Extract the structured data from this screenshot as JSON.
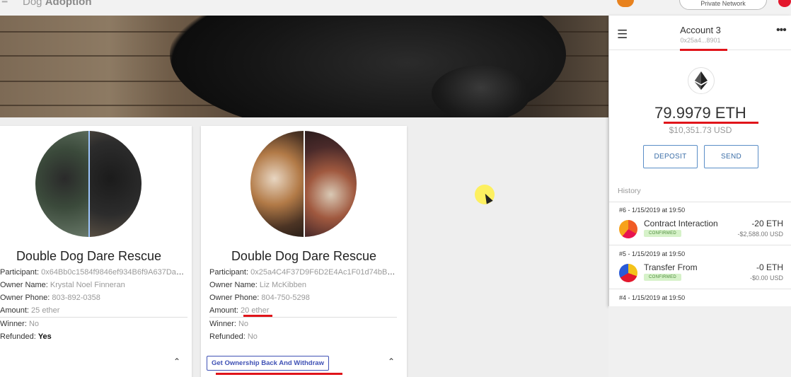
{
  "app": {
    "menu_glyph": "≡",
    "title_prefix": "Dog",
    "title_bold": "Adoption"
  },
  "cards": [
    {
      "title": "Double Dog Dare Rescue",
      "participant_label": "Participant: ",
      "participant": "0x64Bb0c1584f9846ef934B6f9A637Da90...",
      "owner_name_label": "Owner Name: ",
      "owner_name": "Krystal Noel Finneran",
      "owner_phone_label": "Owner Phone: ",
      "owner_phone": "803-892-0358",
      "amount_label": "Amount: ",
      "amount": "25 ether",
      "winner_label": "Winner: ",
      "winner": "No",
      "refunded_label": "Refunded: ",
      "refunded": "Yes",
      "collapse_icon": "chevron-up-icon"
    },
    {
      "title": "Double Dog Dare Rescue",
      "participant_label": "Participant: ",
      "participant": "0x25a4C4F37D9F6D2E4Ac1F01d74bBEf7...",
      "owner_name_label": "Owner Name: ",
      "owner_name": "Liz McKibben",
      "owner_phone_label": "Owner Phone: ",
      "owner_phone": "804-750-5298",
      "amount_label": "Amount: ",
      "amount": "20 ether",
      "winner_label": "Winner: ",
      "winner": "No",
      "refunded_label": "Refunded: ",
      "refunded": "No",
      "action_button": "Get Ownership Back And Withdraw",
      "collapse_icon": "chevron-up-icon"
    }
  ],
  "wallet": {
    "network": "Private Network",
    "account_name": "Account 3",
    "account_address": "0x25a4...8901",
    "balance": "79.9979 ETH",
    "balance_usd": "$10,351.73 USD",
    "deposit_label": "DEPOSIT",
    "send_label": "SEND",
    "history_label": "History",
    "transactions": [
      {
        "date": "#6 - 1/15/2019 at 19:50",
        "title": "Contract Interaction",
        "status": "CONFIRMED",
        "amount": "-20 ETH",
        "amount_usd": "-$2,588.00 USD"
      },
      {
        "date": "#5 - 1/15/2019 at 19:50",
        "title": "Transfer From",
        "status": "CONFIRMED",
        "amount": "-0 ETH",
        "amount_usd": "-$0.00 USD"
      },
      {
        "date": "#4 - 1/15/2019 at 19:50"
      }
    ]
  },
  "colors": {
    "accent_blue": "#3f51b5",
    "highlight_red": "#e0141a",
    "confirmed_green": "#d6f2c9",
    "cursor_highlight": "#fff046"
  }
}
